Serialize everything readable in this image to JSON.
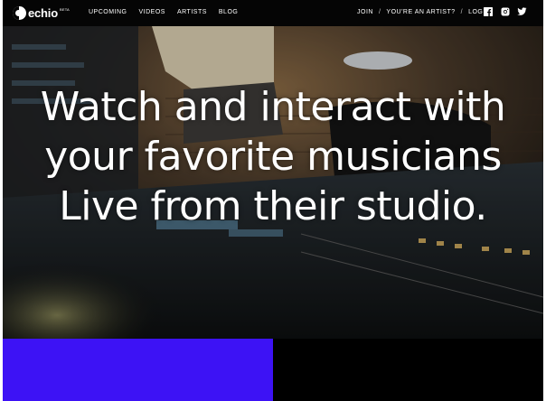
{
  "brand": {
    "name": "echio",
    "badge": "BETA"
  },
  "nav": {
    "left": [
      "UPCOMING",
      "VIDEOS",
      "ARTISTS",
      "BLOG"
    ],
    "right": {
      "join": "JOIN",
      "sep1": "/",
      "artist": "YOU'RE AN ARTIST?",
      "sep2": "/",
      "login": "LOGIN"
    }
  },
  "social": [
    "facebook-icon",
    "instagram-icon",
    "twitter-icon"
  ],
  "hero": {
    "line1": "Watch and interact with",
    "line2": "your favorite musicians",
    "line3": "Live from their studio."
  },
  "colors": {
    "accent": "#3d12f5",
    "nav_bg": "#050505"
  }
}
